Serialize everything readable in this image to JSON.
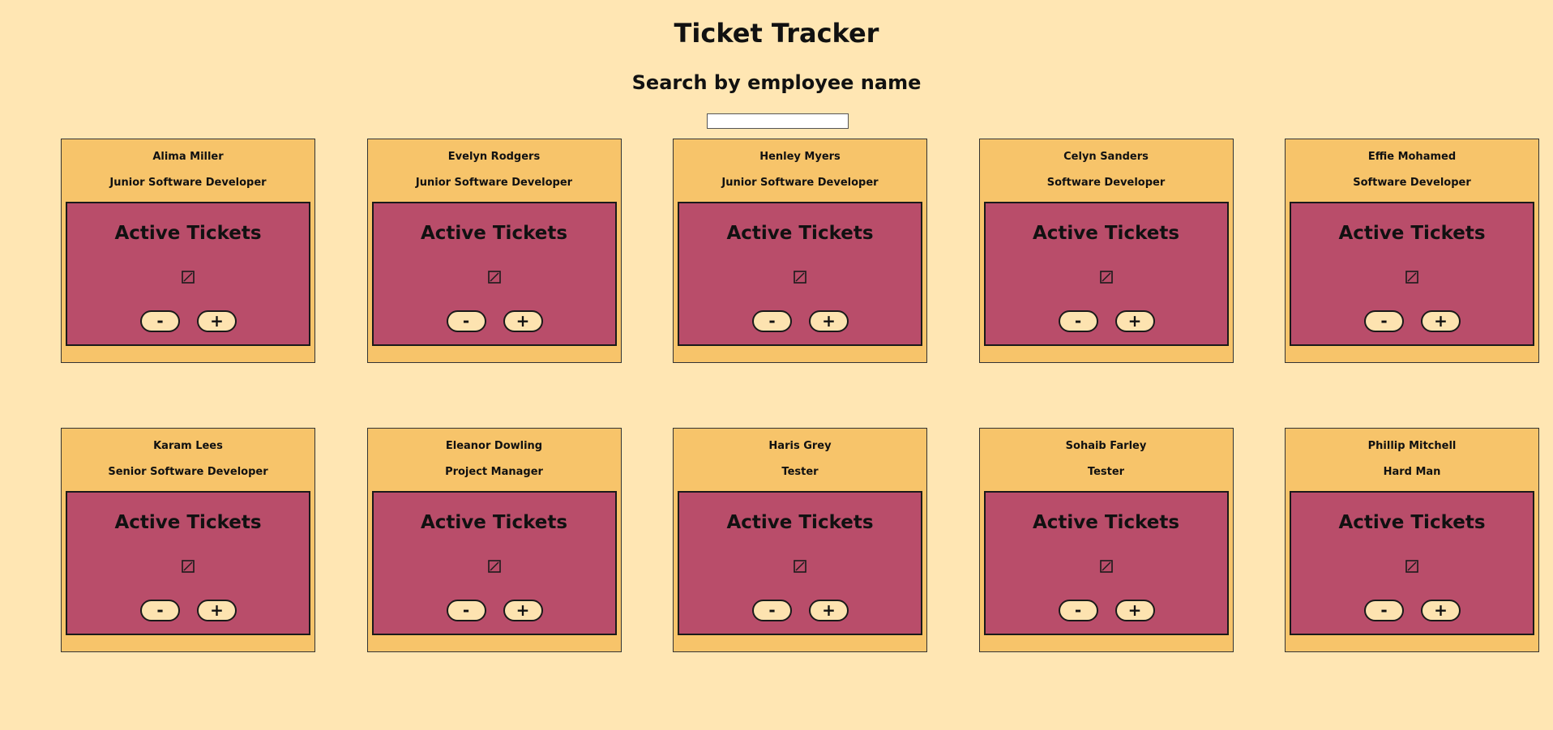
{
  "header": {
    "title": "Ticket Tracker",
    "search_heading": "Search by employee name",
    "search_value": ""
  },
  "card_labels": {
    "active_tickets": "Active Tickets",
    "decrement": "-",
    "increment": "+",
    "ticket_icon": "broken-image-icon"
  },
  "employees": [
    {
      "name": "Alima Miller",
      "role": "Junior Software Developer"
    },
    {
      "name": "Evelyn Rodgers",
      "role": "Junior Software Developer"
    },
    {
      "name": "Henley Myers",
      "role": "Junior Software Developer"
    },
    {
      "name": "Celyn Sanders",
      "role": "Software Developer"
    },
    {
      "name": "Effie Mohamed",
      "role": "Software Developer"
    },
    {
      "name": "Karam Lees",
      "role": "Senior Software Developer"
    },
    {
      "name": "Eleanor Dowling",
      "role": "Project Manager"
    },
    {
      "name": "Haris Grey",
      "role": "Tester"
    },
    {
      "name": "Sohaib Farley",
      "role": "Tester"
    },
    {
      "name": "Phillip Mitchell",
      "role": "Hard Man"
    }
  ],
  "colors": {
    "page_background": "#ffe6b3",
    "card_background": "#f7c46a",
    "tickets_panel": "#b94d6a",
    "button_background": "#fde3b0"
  }
}
